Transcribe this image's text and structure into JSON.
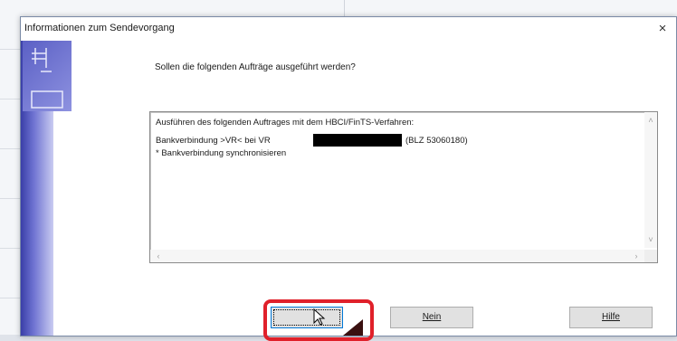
{
  "window": {
    "title": "Informationen zum Sendevorgang",
    "close_label": "×"
  },
  "prompt": {
    "question": "Sollen die folgenden Aufträge ausgeführt werden?"
  },
  "details": {
    "line1": "Ausführen des folgenden Auftrages mit dem HBCI/FinTS-Verfahren:",
    "line2_prefix": "Bankverbindung >VR< bei VR",
    "line2_suffix": "(BLZ 53060180)",
    "line3": "* Bankverbindung synchronisieren"
  },
  "buttons": {
    "yes_label": "",
    "no_label": "Nein",
    "help_label": "Hilfe"
  },
  "scrollbars": {
    "up": "˄",
    "down": "˅",
    "left": "‹",
    "right": "›"
  },
  "colors": {
    "banner_dark": "#3a3fa8",
    "highlight": "#e0202a",
    "focus_border": "#0078d7"
  }
}
